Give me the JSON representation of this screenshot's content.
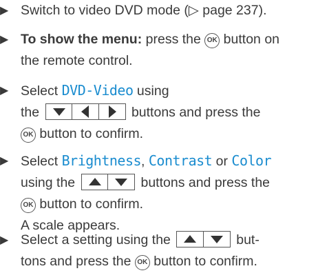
{
  "bullet": "▶",
  "ok_label": "OK",
  "steps": [
    {
      "prefix": "Switch to video DVD mode (▷ page 237)."
    },
    {
      "bold": "To show the menu:",
      "text_a": " press the ",
      "text_b": " button on",
      "line2": "the remote control."
    },
    {
      "text_a": "Select ",
      "item": "DVD-Video",
      "text_b": " using",
      "text_c": "the ",
      "text_d": " buttons and press the",
      "text_e": " button to confirm."
    },
    {
      "text_a": "Select ",
      "item1": "Brightness",
      "sep1": ", ",
      "item2": "Contrast",
      "sep2": " or ",
      "item3": "Color",
      "text_b": "using the ",
      "text_c": " buttons and press the",
      "text_d": " button to confirm.",
      "result": "A scale appears."
    },
    {
      "text_a": "Select a setting using the ",
      "text_b": " but-",
      "text_c": "tons and press the ",
      "text_d": " button to confirm."
    }
  ],
  "icons": [
    "play-bullet-icon",
    "ok-button-icon",
    "down-arrow-key-icon",
    "left-arrow-key-icon",
    "right-arrow-key-icon",
    "up-arrow-key-icon"
  ]
}
